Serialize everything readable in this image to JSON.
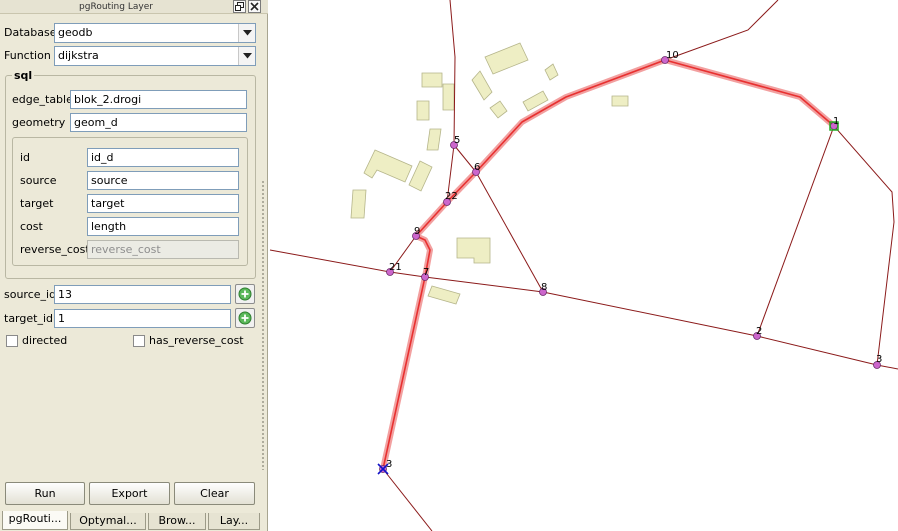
{
  "panel": {
    "title": "pgRouting Layer",
    "database_label": "Database",
    "database_value": "geodb",
    "function_label": "Function",
    "function_value": "dijkstra",
    "sql_group_title": "sql",
    "edge_table_label": "edge_table",
    "edge_table_value": "blok_2.drogi",
    "geometry_label": "geometry",
    "geometry_value": "geom_d",
    "id_label": "id",
    "id_value": "id_d",
    "source_label": "source",
    "source_value": "source",
    "target_label": "target",
    "target_value": "target",
    "cost_label": "cost",
    "cost_value": "length",
    "reverse_cost_label": "reverse_cost",
    "reverse_cost_value": "reverse_cost",
    "source_id_label": "source_id",
    "source_id_value": "13",
    "target_id_label": "target_id",
    "target_id_value": "1",
    "directed_label": "directed",
    "directed_checked": false,
    "has_reverse_cost_label": "has_reverse_cost",
    "has_reverse_cost_checked": false,
    "run_label": "Run",
    "export_label": "Export",
    "clear_label": "Clear"
  },
  "tabs": [
    "pgRouti...",
    "Optymal...",
    "Brow...",
    "Lay..."
  ],
  "map": {
    "colors": {
      "road": "#8b1a1a",
      "route_halo": "#f2a0a0",
      "route": "#e83030",
      "building_fill": "#eeeec4",
      "building_stroke": "#b5b58a",
      "node_fill": "#cc66cc",
      "node_stroke": "#6a2a6a",
      "start_marker": "#1010c8",
      "end_marker": "#22aa22"
    },
    "nodes": [
      {
        "label": "10"
      },
      {
        "label": "1"
      },
      {
        "label": "5"
      },
      {
        "label": "6"
      },
      {
        "label": "22"
      },
      {
        "label": "9"
      },
      {
        "label": "21"
      },
      {
        "label": "7"
      },
      {
        "label": "8"
      },
      {
        "label": "2"
      },
      {
        "label": "3"
      },
      {
        "label": "3"
      }
    ]
  }
}
